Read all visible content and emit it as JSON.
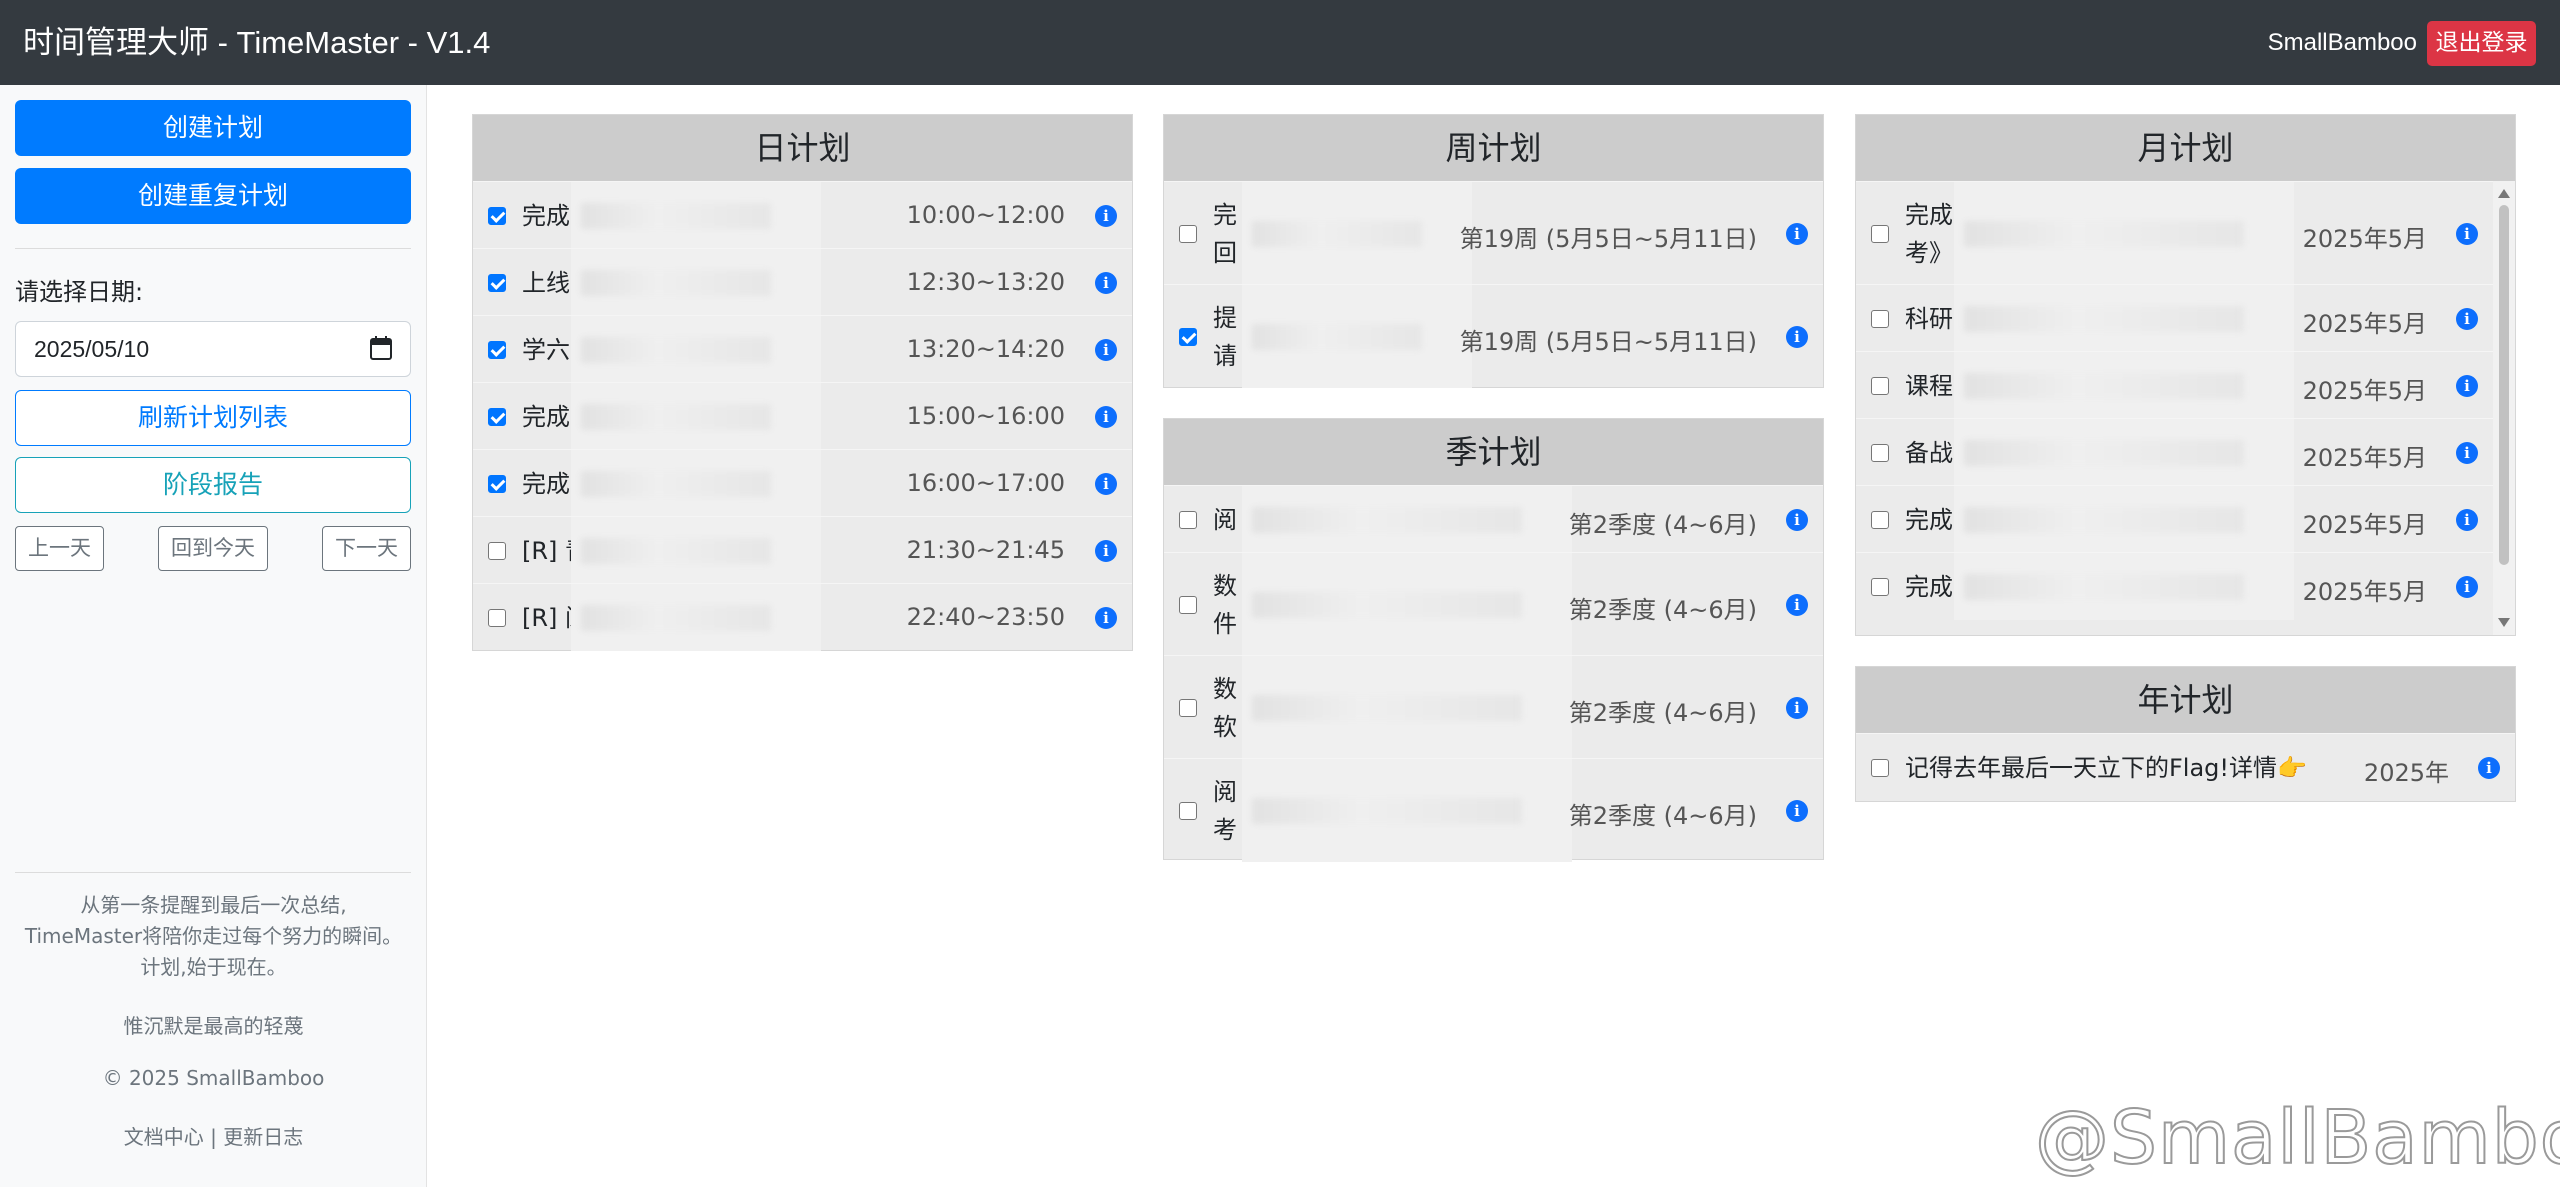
{
  "header": {
    "title": "时间管理大师 - TimeMaster - V1.4",
    "username": "SmallBamboo",
    "logout_label": "退出登录"
  },
  "sidebar": {
    "create_plan": "创建计划",
    "create_repeat_plan": "创建重复计划",
    "date_label": "请选择日期:",
    "date_value": "2025/05/10",
    "refresh_label": "刷新计划列表",
    "report_label": "阶段报告",
    "prev_day": "上一天",
    "today": "回到今天",
    "next_day": "下一天",
    "footer": {
      "line1": "从第一条提醒到最后一次总结,",
      "line2": "TimeMaster将陪你走过每个努力的瞬间。",
      "line3": "计划,始于现在。",
      "quote": "惟沉默是最高的轻蔑",
      "copyright": "© 2025 SmallBamboo",
      "docs": "文档中心",
      "separator": "|",
      "changelog": "更新日志"
    }
  },
  "day_plan": {
    "title": "日计划",
    "items": [
      {
        "prefix": "完成",
        "time": "10:00~12:00",
        "checked": true
      },
      {
        "prefix": "上线",
        "time": "12:30~13:20",
        "checked": true
      },
      {
        "prefix": "学六",
        "time": "13:20~14:20",
        "checked": true
      },
      {
        "prefix": "完成",
        "time": "15:00~16:00",
        "checked": true
      },
      {
        "prefix": "完成",
        "time": "16:00~17:00",
        "checked": true
      },
      {
        "prefix": "[R] 青",
        "time": "21:30~21:45",
        "checked": false
      },
      {
        "prefix": "[R] 阅",
        "time": "22:40~23:50",
        "checked": false
      }
    ]
  },
  "week_plan": {
    "title": "周计划",
    "items": [
      {
        "line1": "完",
        "line2": "回",
        "period": "第19周 (5月5日~5月11日)",
        "checked": false
      },
      {
        "line1": "提",
        "line2": "请",
        "period": "第19周 (5月5日~5月11日)",
        "checked": true
      }
    ]
  },
  "quarter_plan": {
    "title": "季计划",
    "items": [
      {
        "line1": "阅",
        "line2": "",
        "period": "第2季度 (4~6月)",
        "checked": false
      },
      {
        "line1": "数",
        "line2": "件",
        "period": "第2季度 (4~6月)",
        "checked": false
      },
      {
        "line1": "数",
        "line2": "软",
        "period": "第2季度 (4~6月)",
        "checked": false
      },
      {
        "line1": "阅",
        "line2": "考",
        "period": "第2季度 (4~6月)",
        "checked": false
      }
    ]
  },
  "month_plan": {
    "title": "月计划",
    "items": [
      {
        "line1": "完成",
        "line2": "考》",
        "period": "2025年5月",
        "checked": false
      },
      {
        "line1": "科研",
        "line2": "",
        "period": "2025年5月",
        "checked": false
      },
      {
        "line1": "课程",
        "line2": "",
        "period": "2025年5月",
        "checked": false
      },
      {
        "line1": "备战",
        "line2": "",
        "period": "2025年5月",
        "checked": false
      },
      {
        "line1": "完成",
        "line2": "",
        "period": "2025年5月",
        "checked": false
      },
      {
        "line1": "完成",
        "line2": "",
        "period": "2025年5月",
        "checked": false
      }
    ]
  },
  "year_plan": {
    "title": "年计划",
    "items": [
      {
        "line1": "记得去年最后一天立下的Flag!详情👉",
        "period": "2025年",
        "checked": false
      }
    ]
  },
  "icons": {
    "info": "info-icon",
    "calendar": "calendar-icon",
    "check": "checkbox"
  },
  "colors": {
    "header_bg": "#343a40",
    "primary": "#007bff",
    "danger": "#dc3545",
    "info": "#17a2b8",
    "panel_header": "#cccccc"
  },
  "watermark": "@SmallBamboo"
}
